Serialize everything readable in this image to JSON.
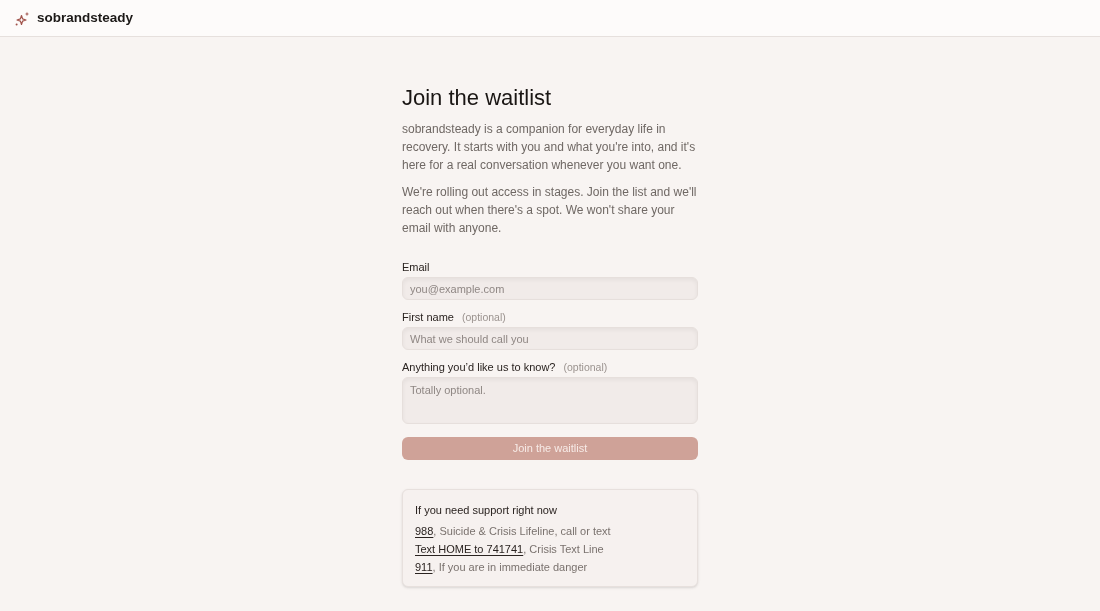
{
  "header": {
    "brand": "sobrandsteady"
  },
  "title": "Join the waitlist",
  "paragraphs": [
    "sobrandsteady is a companion for everyday life in recovery. It starts with you and what you're into, and it's here for a real conversation whenever you want one.",
    "We're rolling out access in stages. Join the list and we'll reach out when there's a spot. We won't share your email with anyone."
  ],
  "form": {
    "fields": [
      {
        "kind": "input",
        "label": "Email",
        "placeholder": "you@example.com"
      },
      {
        "kind": "input",
        "label": "First name",
        "hint": "(optional)",
        "placeholder": "What we should call you"
      },
      {
        "kind": "textarea",
        "label": "Anything you’d like us to know?",
        "hint": "(optional)",
        "placeholder": "Totally optional."
      }
    ],
    "submit": {
      "label": "Join the waitlist",
      "disabled": true
    }
  },
  "support": {
    "title": "If you need support right now",
    "lines": [
      {
        "link": "988",
        "text": ", Suicide & Crisis Lifeline, call or text"
      },
      {
        "link": "Text HOME to 741741",
        "text": ", Crisis Text Line"
      },
      {
        "link": "911",
        "text": ", If you are in immediate danger"
      }
    ]
  }
}
